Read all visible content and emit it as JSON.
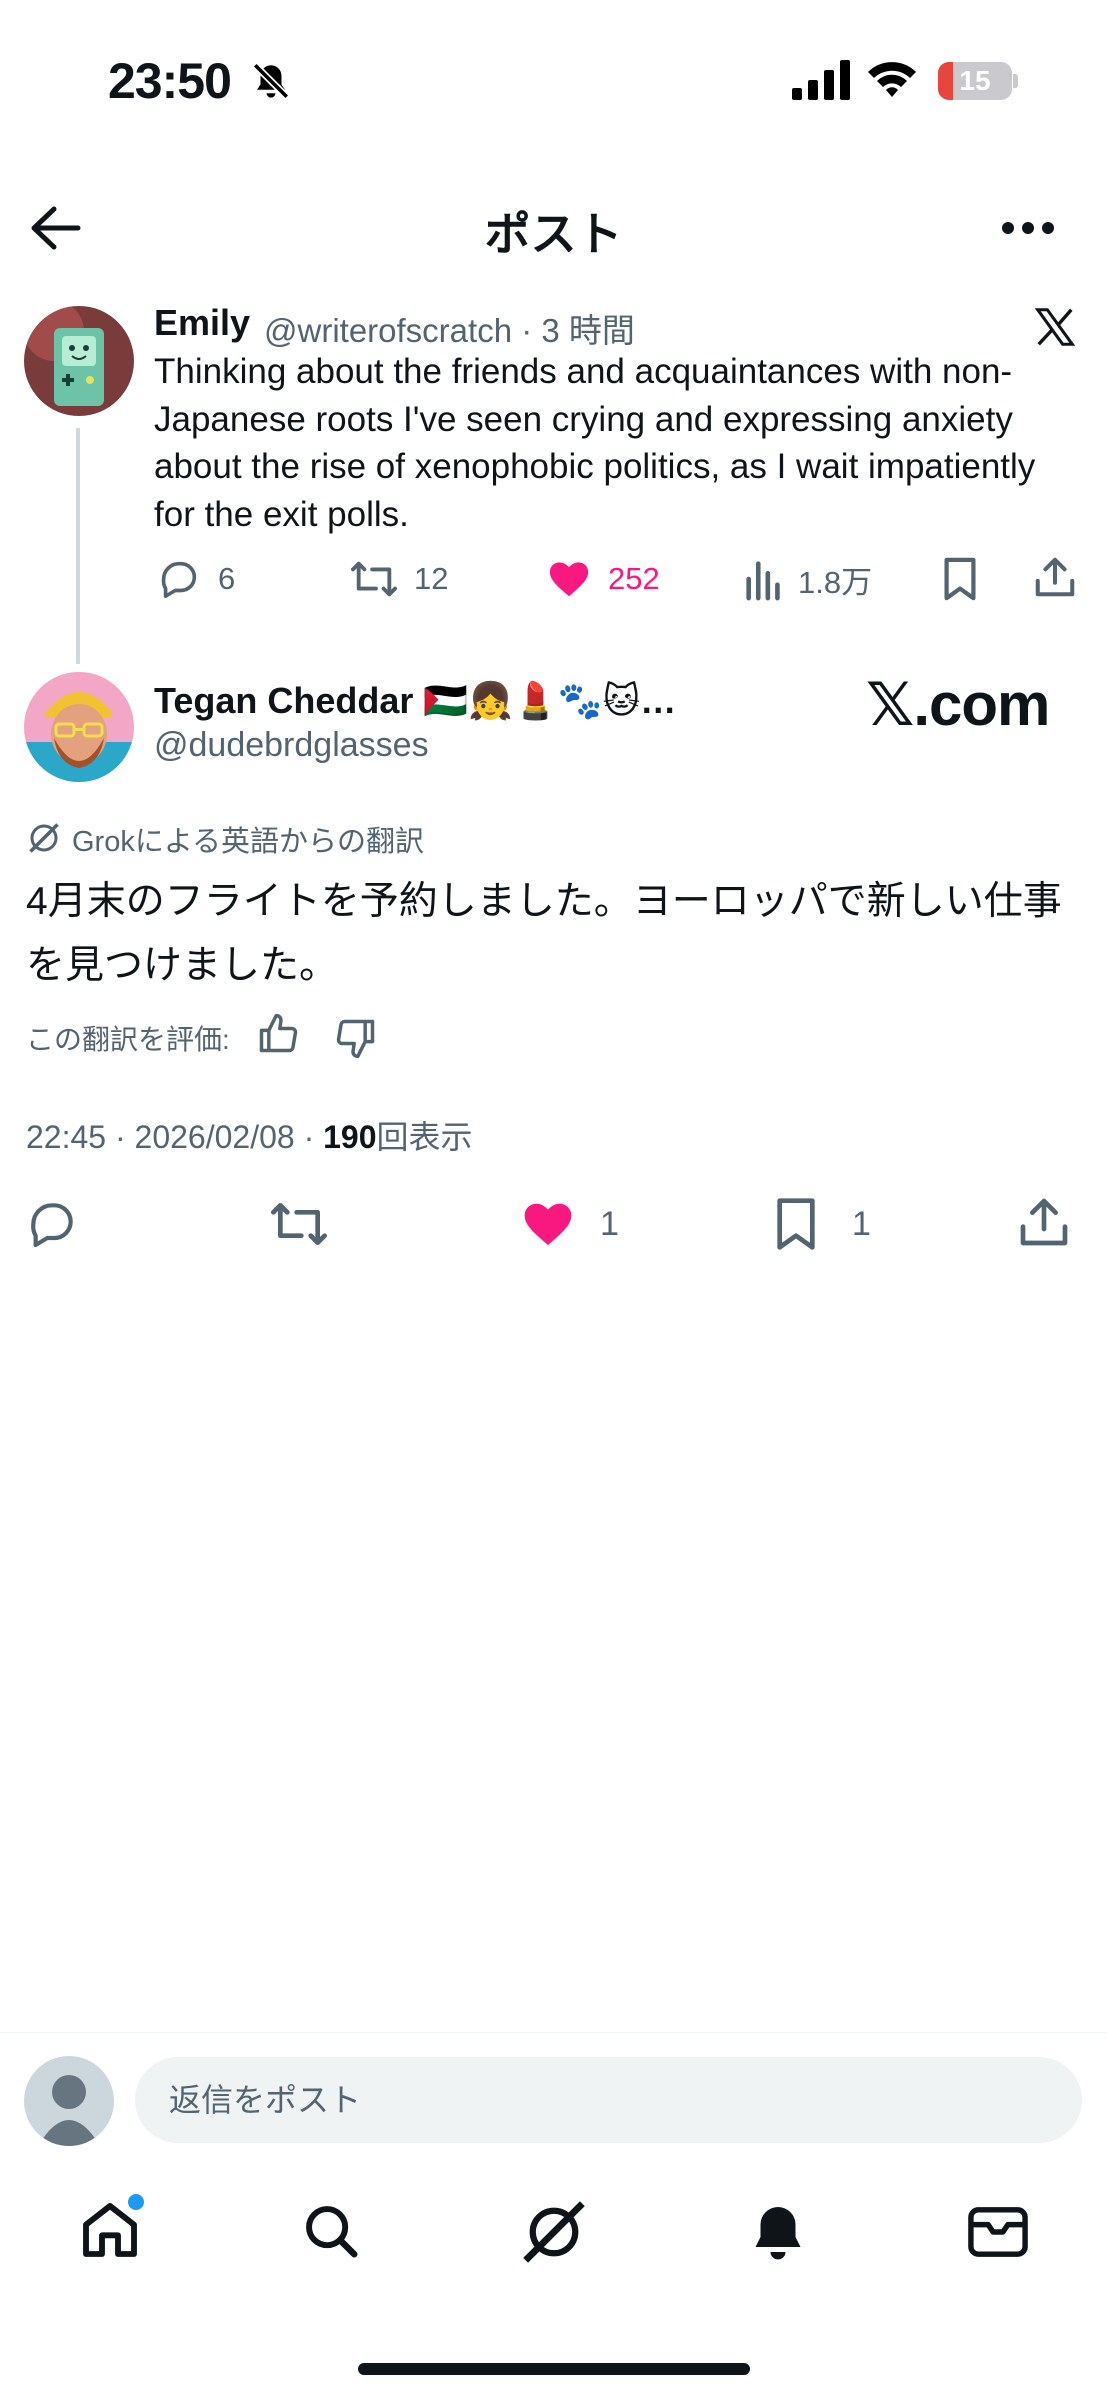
{
  "status_bar": {
    "time": "23:50",
    "battery": "15"
  },
  "header": {
    "title": "ポスト"
  },
  "quoted_post": {
    "author_name": "Emily",
    "author_handle": "@writerofscratch",
    "separator": "·",
    "time_ago": "3 時間",
    "text": "Thinking about the friends and acquaintances with non-Japanese roots I've seen crying and expressing anxiety about the rise of xenophobic politics, as I wait impatiently for the exit polls.",
    "replies": "6",
    "reposts": "12",
    "likes": "252",
    "views": "1.8万",
    "liked": true
  },
  "main_post": {
    "author_name": "Tegan Cheddar 🇵🇸👧💄🐾🐱…",
    "author_handle": "@dudebrdglasses",
    "brand_text": "𝕏.com",
    "translation_label": "Grokによる英語からの翻訳",
    "text": "4月末のフライトを予約しました。ヨーロッパで新しい仕事を見つけました。",
    "rate_label": "この翻訳を評価:",
    "time": "22:45",
    "date": "2026/02/08",
    "dot": "·",
    "view_count": "190",
    "view_label": "回表示",
    "likes": "1",
    "bookmarks": "1"
  },
  "reply_bar": {
    "placeholder": "返信をポスト"
  },
  "nav": {
    "items": [
      "home-icon",
      "search-icon",
      "grok-icon",
      "notifications-icon",
      "messages-icon"
    ]
  },
  "colors": {
    "like": "#f91880",
    "text": "#0f1419",
    "secondary": "#536471",
    "accent": "#1d9bf0"
  }
}
